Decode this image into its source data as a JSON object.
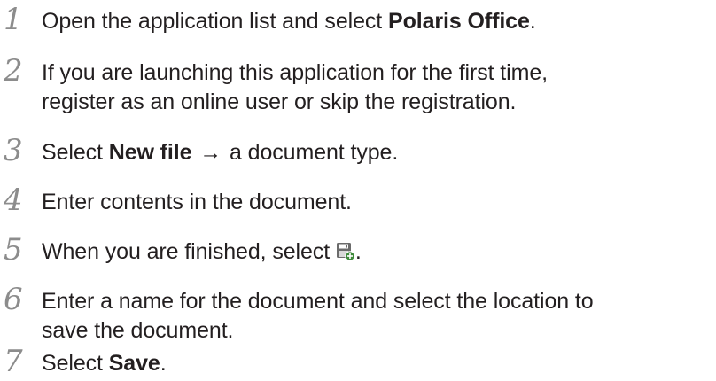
{
  "steps": [
    {
      "number": "1",
      "before": "Open the application list and select ",
      "bold": "Polaris Office",
      "after": "."
    },
    {
      "number": "2",
      "line1": "If you are launching this application for the first time,",
      "line2": "register as an online user or skip the registration."
    },
    {
      "number": "3",
      "before": "Select ",
      "bold": "New file",
      "arrow": "→",
      "after": " a document type."
    },
    {
      "number": "4",
      "text": "Enter contents in the document."
    },
    {
      "number": "5",
      "before": "When you are finished, select ",
      "icon": "save-as-document-icon",
      "after": "."
    },
    {
      "number": "6",
      "line1": "Enter a name for the document and select the location to",
      "line2": "save the document."
    },
    {
      "number": "7",
      "before": "Select ",
      "bold": "Save",
      "after": "."
    }
  ],
  "colors": {
    "text": "#231f20",
    "step_number": "#8c8c8c",
    "icon_green": "#3d8a3a"
  }
}
